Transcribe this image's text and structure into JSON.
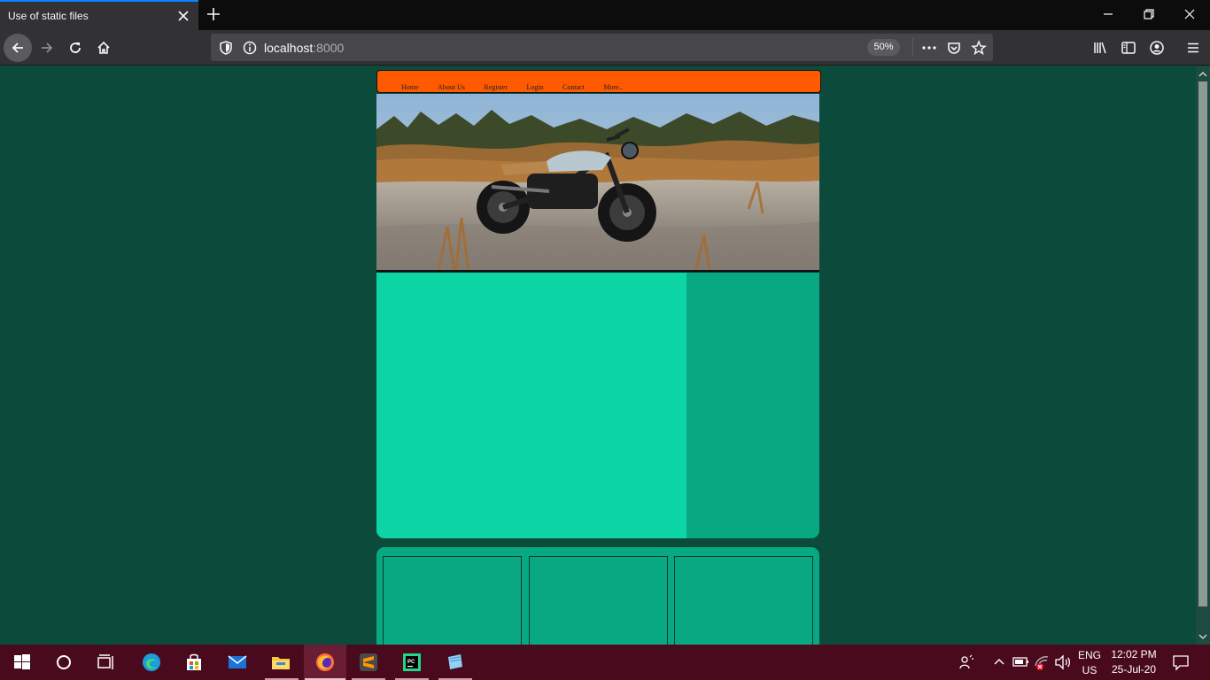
{
  "browser": {
    "tab_title": "Use of static files",
    "url_host": "localhost",
    "url_port": ":8000",
    "zoom": "50%"
  },
  "site": {
    "nav_items": [
      "Home",
      "About Us",
      "Register",
      "Login",
      "Contact",
      "More.."
    ],
    "colors": {
      "page_bg": "#0c4a3c",
      "nav_bg": "#ff5a00",
      "main_col": "#0cd4a4",
      "side_col": "#08a882"
    }
  },
  "taskbar": {
    "language_top": "ENG",
    "language_bottom": "US",
    "time": "12:02 PM",
    "date": "25-Jul-20",
    "apps": [
      "edge-icon",
      "store-icon",
      "mail-icon",
      "file-explorer-icon",
      "firefox-icon",
      "sublime-text-icon",
      "pycharm-icon",
      "notes-icon"
    ]
  }
}
